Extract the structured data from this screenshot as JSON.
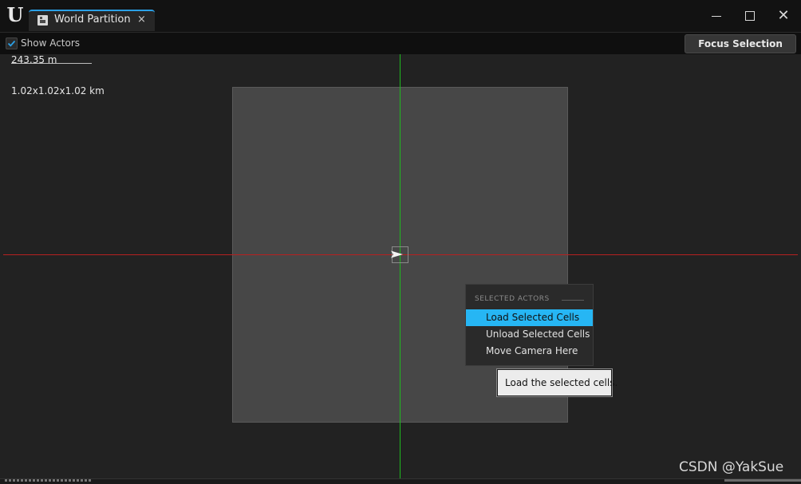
{
  "window": {
    "tab_title": "World Partition",
    "tab_close_glyph": "×",
    "logo_glyph": "U",
    "controls": {
      "minimize_icon": "minimize-icon",
      "maximize_icon": "maximize-icon",
      "close_glyph": "✕"
    }
  },
  "toolbar": {
    "show_actors_label": "Show Actors",
    "show_actors_checked": true,
    "focus_button_label": "Focus Selection"
  },
  "viewport": {
    "scale_label": "243.35 m",
    "bounds_label": "1.02x1.02x1.02 km"
  },
  "context_menu": {
    "heading": "SELECTED ACTORS",
    "items": [
      {
        "label": "Load Selected Cells",
        "highlighted": true
      },
      {
        "label": "Unload Selected Cells",
        "highlighted": false
      },
      {
        "label": "Move Camera Here",
        "highlighted": false
      }
    ]
  },
  "tooltip": {
    "text": "Load the selected cells."
  },
  "watermark": {
    "text": "CSDN @YakSue"
  },
  "colors": {
    "accent": "#26b6f4",
    "axis_x": "#b82020",
    "axis_y": "#1fb81f",
    "tab_highlight": "#2aa0e6"
  }
}
